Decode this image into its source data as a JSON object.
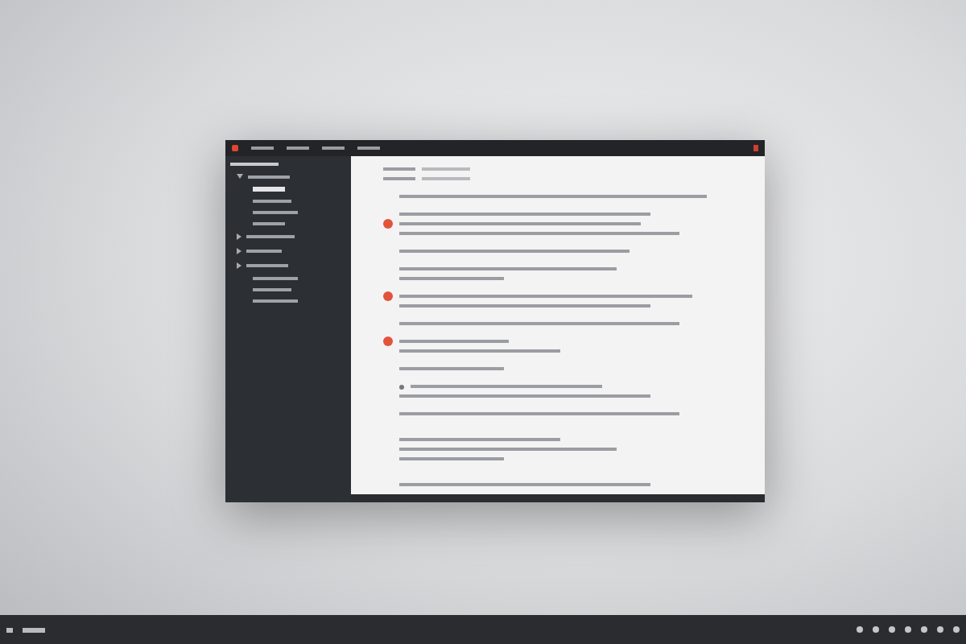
{
  "window": {
    "menu": [
      {
        "kind": "logo"
      },
      {
        "kind": "menu-item"
      },
      {
        "kind": "menu-item"
      },
      {
        "kind": "menu-item"
      },
      {
        "kind": "menu-item"
      },
      {
        "kind": "close"
      }
    ],
    "sidebar": {
      "items": [
        {
          "kind": "header"
        },
        {
          "kind": "folder",
          "expanded": true,
          "children": [
            {
              "kind": "item",
              "selected": true
            },
            {
              "kind": "item",
              "selected": false
            },
            {
              "kind": "item",
              "selected": false
            },
            {
              "kind": "item",
              "selected": false
            }
          ]
        },
        {
          "kind": "folder",
          "expanded": false
        },
        {
          "kind": "folder",
          "expanded": false
        },
        {
          "kind": "folder",
          "expanded": false
        },
        {
          "kind": "item",
          "selected": false
        },
        {
          "kind": "item",
          "selected": false
        },
        {
          "kind": "item",
          "selected": false
        }
      ]
    },
    "content": {
      "lines": [
        {
          "kind": "field"
        },
        {
          "kind": "field"
        },
        {
          "kind": "gap"
        },
        {
          "kind": "text"
        },
        {
          "kind": "gap"
        },
        {
          "kind": "text"
        },
        {
          "kind": "comment"
        },
        {
          "kind": "text"
        },
        {
          "kind": "gap"
        },
        {
          "kind": "text"
        },
        {
          "kind": "gap"
        },
        {
          "kind": "text"
        },
        {
          "kind": "text"
        },
        {
          "kind": "gap"
        },
        {
          "kind": "comment"
        },
        {
          "kind": "text"
        },
        {
          "kind": "gap"
        },
        {
          "kind": "text"
        },
        {
          "kind": "gap"
        },
        {
          "kind": "comment"
        },
        {
          "kind": "text"
        },
        {
          "kind": "gap"
        },
        {
          "kind": "text"
        },
        {
          "kind": "gap"
        },
        {
          "kind": "bullet"
        },
        {
          "kind": "text"
        },
        {
          "kind": "gap"
        },
        {
          "kind": "text"
        },
        {
          "kind": "gap"
        },
        {
          "kind": "gap"
        },
        {
          "kind": "text"
        },
        {
          "kind": "text"
        },
        {
          "kind": "text"
        },
        {
          "kind": "gap"
        },
        {
          "kind": "gap"
        },
        {
          "kind": "text"
        }
      ]
    }
  },
  "taskbar": {
    "tray": [
      {
        "kind": "icon"
      },
      {
        "kind": "icon"
      },
      {
        "kind": "icon"
      },
      {
        "kind": "icon"
      },
      {
        "kind": "icon"
      },
      {
        "kind": "icon"
      },
      {
        "kind": "icon"
      }
    ]
  }
}
